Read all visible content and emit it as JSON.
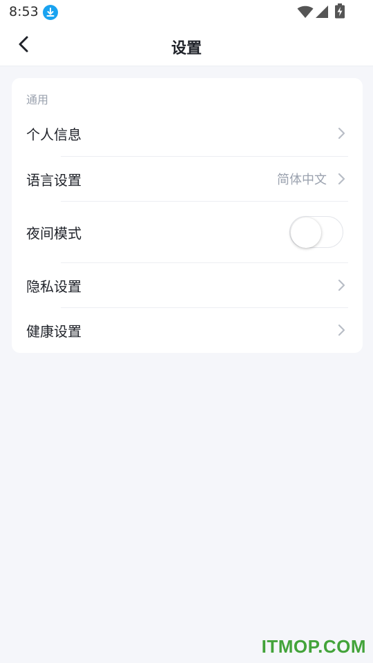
{
  "status_bar": {
    "time": "8:53",
    "download_icon": "download-icon",
    "wifi_icon": "wifi-icon",
    "signal_icon": "signal-icon",
    "battery_icon": "battery-charging-icon",
    "download_color": "#1aa3f0"
  },
  "nav": {
    "back_icon": "chevron-left-icon",
    "title": "设置"
  },
  "settings": {
    "section_label": "通用",
    "items": [
      {
        "label": "个人信息",
        "value": "",
        "control": "chevron-right-icon"
      },
      {
        "label": "语言设置",
        "value": "简体中文",
        "control": "chevron-right-icon"
      },
      {
        "label": "夜间模式",
        "value": "",
        "control": "toggle",
        "toggle_on": false
      },
      {
        "label": "隐私设置",
        "value": "",
        "control": "chevron-right-icon"
      },
      {
        "label": "健康设置",
        "value": "",
        "control": "chevron-right-icon"
      }
    ]
  },
  "watermark": {
    "text": "ITMOP.COM",
    "color": "#43a33a"
  },
  "colors": {
    "page_background": "#f5f6fa",
    "card_background": "#ffffff",
    "muted_text": "#9aa1ae"
  }
}
